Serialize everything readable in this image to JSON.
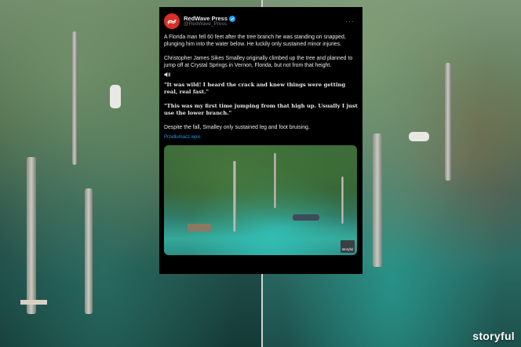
{
  "tweet": {
    "display_name": "RedWave Press",
    "handle": "@RedWave_Press",
    "paragraphs": [
      "A Florida man fell 60 feet after the tree branch he was standing on snapped, plunging him into the water below. He luckily only sustained minor injuries.",
      "Christopher James Sikes Smalley originally climbed up the tree and planned to jump off at Crystal Springs in Vernon, Florida, but not from that height."
    ],
    "quote_1": "\"It was wild! I heard the crack and knew things were getting real, real fast.\"",
    "quote_2": "\"This was my first time jumping from that high up. Usually I just use the lower branch.\"",
    "closing": "Despite the fall, Smalley only sustained leg and foot bruising.",
    "translate_label": "Przetłumacz wpis",
    "media_badge": "storyful"
  },
  "video": {
    "watermark": "storyful"
  },
  "icons": {
    "avatar": "redwave-logo-icon",
    "verified": "verified-badge-icon",
    "more": "more-options-icon",
    "speaker": "speaker-icon"
  },
  "colors": {
    "card_background": "#000000",
    "text": "#e7e9ea",
    "muted": "#71767b",
    "link": "#1d9bf0",
    "avatar": "#d93025"
  }
}
